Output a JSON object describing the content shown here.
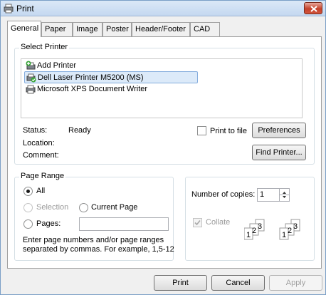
{
  "window": {
    "title": "Print"
  },
  "tabs": [
    "General",
    "Paper",
    "Image",
    "Poster",
    "Header/Footer",
    "CAD"
  ],
  "select_printer": {
    "label": "Select Printer",
    "printers": [
      "Add Printer",
      "Dell Laser Printer M5200 (MS)",
      "Microsoft XPS Document Writer"
    ],
    "selected_index": 1,
    "status_label": "Status:",
    "status_value": "Ready",
    "location_label": "Location:",
    "comment_label": "Comment:",
    "print_to_file_label": "Print to file",
    "print_to_file_checked": false,
    "preferences_button": "Preferences",
    "find_printer_button": "Find Printer..."
  },
  "page_range": {
    "label": "Page Range",
    "all_label": "All",
    "selection_label": "Selection",
    "current_page_label": "Current Page",
    "pages_label": "Pages:",
    "pages_value": "",
    "selected": "All",
    "help_line1": "Enter page numbers and/or page ranges",
    "help_line2": "separated by commas.  For example, 1,5-12"
  },
  "copies": {
    "label": "Number of copies:",
    "value": "1",
    "collate_label": "Collate",
    "collate_checked": true,
    "collate_digits": [
      "1",
      "2",
      "3"
    ]
  },
  "footer": {
    "print_button": "Print",
    "cancel_button": "Cancel",
    "apply_button": "Apply"
  },
  "colors": {
    "selection_bg": "#dceaf9",
    "selection_border": "#84acdd",
    "close_button": "#c4422b"
  }
}
